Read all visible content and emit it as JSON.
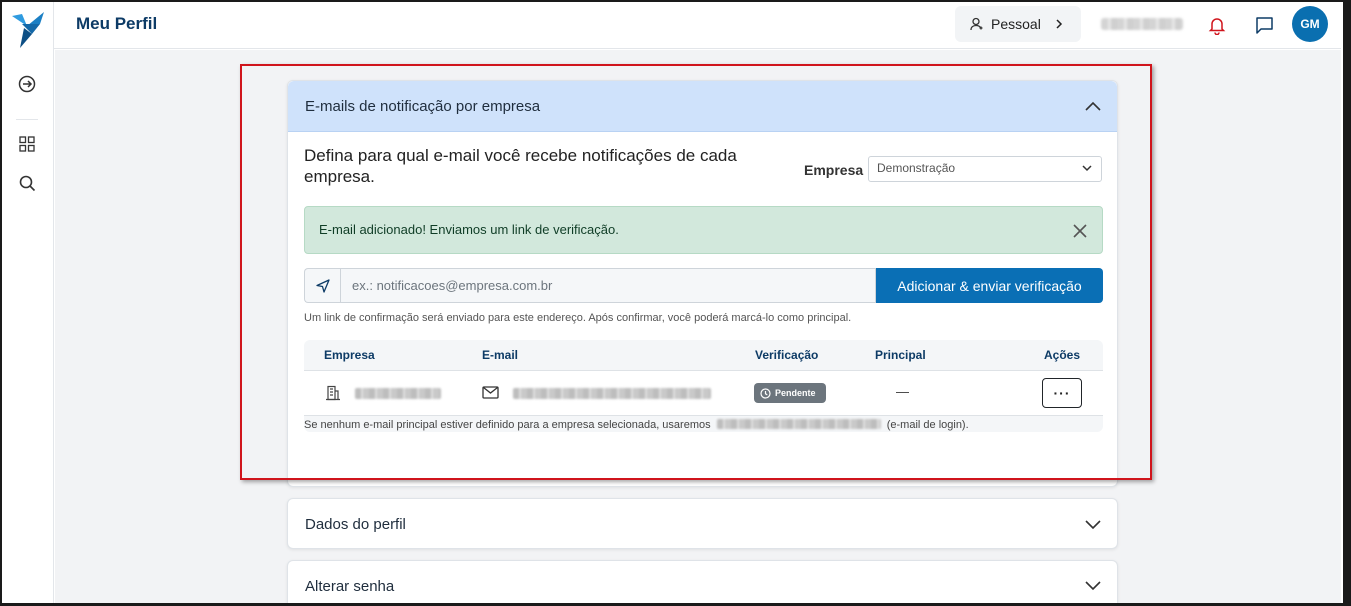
{
  "header": {
    "title": "Meu Perfil",
    "context_label": "Pessoal",
    "avatar_initials": "GM"
  },
  "colors": {
    "primary": "#0a6fb5",
    "brand": "#0d3b66",
    "notification": "#d0141c"
  },
  "notification_card": {
    "title": "E-mails de notificação por empresa",
    "intro": "Defina para qual e-mail você recebe notificações de cada empresa.",
    "company_label": "Empresa",
    "company_selected": "Demonstração",
    "alert_text": "E-mail adicionado! Enviamos um link de verificação.",
    "email_placeholder": "ex.: notificacoes@empresa.com.br",
    "add_button": "Adicionar & enviar verificação",
    "hint": "Um link de confirmação será enviado para este endereço. Após confirmar, você poderá marcá-lo como principal.",
    "table": {
      "headers": {
        "company": "Empresa",
        "email": "E-mail",
        "verification": "Verificação",
        "principal": "Principal",
        "actions": "Ações"
      },
      "rows": [
        {
          "status": "Pendente",
          "principal": "—",
          "actions_label": "···"
        }
      ]
    },
    "footer_before": "Se nenhum e-mail principal estiver definido para a empresa selecionada, usaremos",
    "footer_after": "(e-mail de login)."
  },
  "sections": {
    "profile": "Dados do perfil",
    "password": "Alterar senha"
  }
}
